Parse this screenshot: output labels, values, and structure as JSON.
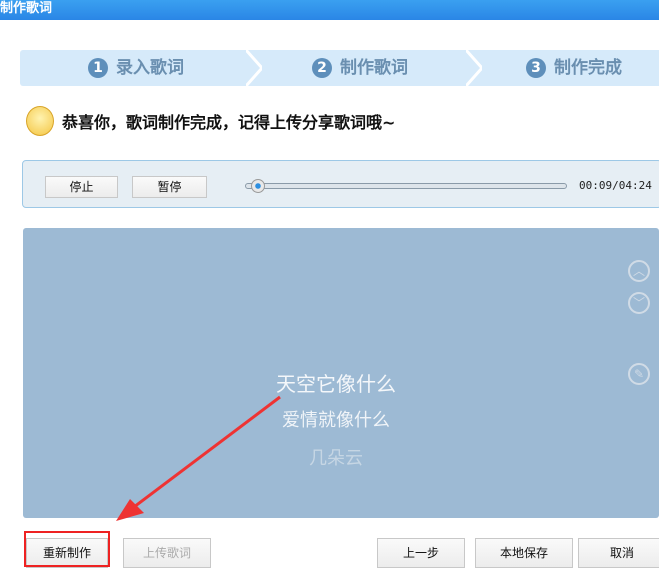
{
  "window": {
    "title": "制作歌词"
  },
  "steps": [
    {
      "num": "1",
      "label": "录入歌词"
    },
    {
      "num": "2",
      "label": "制作歌词"
    },
    {
      "num": "3",
      "label": "制作完成"
    }
  ],
  "message": "恭喜你，歌词制作完成，记得上传分享歌词哦~",
  "player": {
    "stop": "停止",
    "pause": "暂停",
    "time": "00:09/04:24",
    "progress": 0.034
  },
  "lyrics": [
    "天空它像什么",
    "爱情就像什么",
    "几朵云"
  ],
  "footer": {
    "remake": "重新制作",
    "upload": "上传歌词",
    "prev": "上一步",
    "save_local": "本地保存",
    "cancel": "取消"
  },
  "colors": {
    "accent": "#2a86e6",
    "highlight": "#ee2222"
  }
}
